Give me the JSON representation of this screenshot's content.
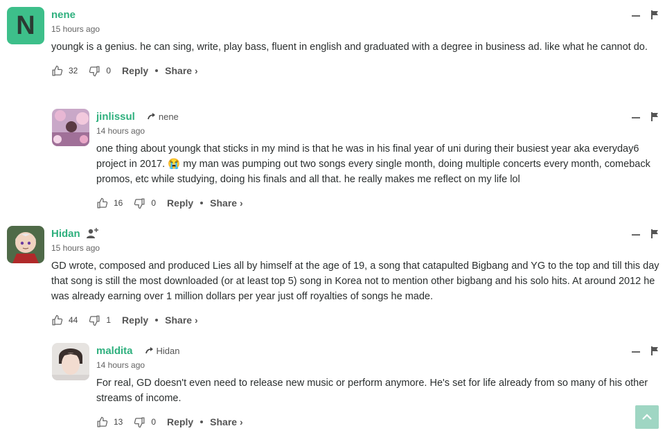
{
  "comments": [
    {
      "avatar_letter": "N",
      "author": "nene",
      "time": "15 hours ago",
      "text": "youngk is a genius. he can sing, write, play bass, fluent in english and graduated with a degree in business ad. like what he cannot do.",
      "upvotes": "32",
      "downvotes": "0",
      "reply_label": "Reply",
      "share_label": "Share ›"
    },
    {
      "author": "jinlissul",
      "reply_to": "nene",
      "time": "14 hours ago",
      "text": "one thing about youngk that sticks in my mind is that he was in his final year of uni during their busiest year aka everyday6 project in 2017. 😭 my man was pumping out two songs every single month, doing multiple concerts every month, comeback promos, etc while studying, doing his finals and all that. he really makes me reflect on my life lol",
      "upvotes": "16",
      "downvotes": "0",
      "reply_label": "Reply",
      "share_label": "Share ›"
    },
    {
      "author": "Hidan",
      "time": "15 hours ago",
      "text": "GD wrote, composed and produced Lies all by himself at the age of 19, a song that catapulted Bigbang and YG to the top and till this day that song is still the most downloaded (or at least top 5) song in Korea not to mention other bigbang and his solo hits. At around 2012 he was already earning over 1 million dollars per year just off royalties of songs he made.",
      "upvotes": "44",
      "downvotes": "1",
      "reply_label": "Reply",
      "share_label": "Share ›"
    },
    {
      "author": "maldita",
      "reply_to": "Hidan",
      "time": "14 hours ago",
      "text": "For real, GD doesn't even need to release new music or perform anymore. He's set for life already from so many of his other streams of income.",
      "upvotes": "13",
      "downvotes": "0",
      "reply_label": "Reply",
      "share_label": "Share ›"
    }
  ],
  "colors": {
    "accent": "#2fb07e",
    "avatar_bg": "#3dbf8a",
    "scroll_button": "#9fd6c3"
  },
  "icons": [
    "thumbs-up-icon",
    "thumbs-down-icon",
    "flag-icon",
    "collapse-icon",
    "reply-arrow-icon",
    "follow-user-icon",
    "chevron-up-icon"
  ]
}
